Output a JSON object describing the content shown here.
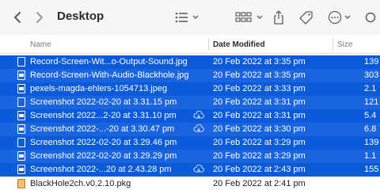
{
  "toolbar": {
    "back_icon": "chevron-left-icon",
    "forward_icon": "chevron-right-icon",
    "title": "Desktop",
    "view_icon": "list-view-icon",
    "group_icon": "grid-view-icon",
    "share_icon": "share-icon",
    "tag_icon": "tag-icon",
    "more_icon": "more-icon"
  },
  "columns": {
    "name": "Name",
    "date_modified": "Date Modified",
    "size": "Size"
  },
  "files": [
    {
      "name": "Record-Screen-Wit...o-Output-Sound.jpg",
      "date": "20 Feb 2022 at 3:35 pm",
      "size": "139",
      "cloud": false
    },
    {
      "name": "Record-Screen-With-Audio-Blackhole.jpg",
      "date": "20 Feb 2022 at 3:35 pm",
      "size": "303",
      "cloud": false
    },
    {
      "name": "pexels-magda-ehlers-1054713.jpeg",
      "date": "20 Feb 2022 at 3:33 pm",
      "size": "2.1",
      "cloud": false
    },
    {
      "name": "Screenshot 2022-02-20 at 3.31.15 pm",
      "date": "20 Feb 2022 at 3:31 pm",
      "size": "121",
      "cloud": false
    },
    {
      "name": "Screenshot 2022...2-20 at 3.31.10 pm",
      "date": "20 Feb 2022 at 3:31 pm",
      "size": "5.4",
      "cloud": true
    },
    {
      "name": "Screenshot 2022-...-20 at 3.30.47 pm",
      "date": "20 Feb 2022 at 3:30 pm",
      "size": "6.8",
      "cloud": true
    },
    {
      "name": "Screenshot 2022-02-20 at 3.29.46 pm",
      "date": "20 Feb 2022 at 3:29 pm",
      "size": "139",
      "cloud": false
    },
    {
      "name": "Screenshot 2022-02-20 at 3.29.29 pm",
      "date": "20 Feb 2022 at 3:29 pm",
      "size": "1.1",
      "cloud": false
    },
    {
      "name": "Screenshot 2022-...20 at 2.43.28 pm",
      "date": "20 Feb 2022 at 2:43 pm",
      "size": "155",
      "cloud": true
    },
    {
      "name": "BlackHole2ch.v0.2.10.pkg",
      "date": "20 Feb 2022 at 2:41 pm",
      "size": "",
      "cloud": false
    }
  ],
  "colors": {
    "selection": "#0b5ad9",
    "toolbar_bg": "#f6f6f6"
  }
}
